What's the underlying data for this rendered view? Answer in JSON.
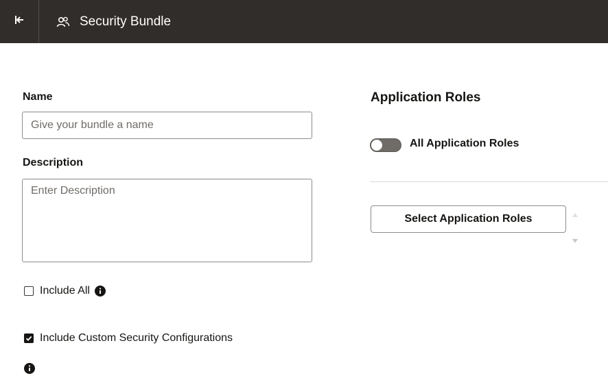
{
  "header": {
    "title": "Security Bundle",
    "collapse_icon": "collapse-left-icon",
    "title_icon": "users-icon",
    "background": "#312d2a"
  },
  "form": {
    "name": {
      "label": "Name",
      "placeholder": "Give your bundle a name",
      "value": ""
    },
    "description": {
      "label": "Description",
      "placeholder": "Enter Description",
      "value": ""
    },
    "include_all": {
      "label": "Include All",
      "checked": false,
      "info_icon": "info-icon"
    },
    "include_custom": {
      "label": "Include Custom Security Configurations",
      "checked": true,
      "info_icon": "info-icon"
    }
  },
  "application_roles": {
    "title": "Application Roles",
    "toggle": {
      "label": "All Application Roles",
      "on": false
    },
    "select_button": "Select Application Roles",
    "scroll_up_icon": "caret-up-icon",
    "scroll_down_icon": "caret-down-icon"
  }
}
